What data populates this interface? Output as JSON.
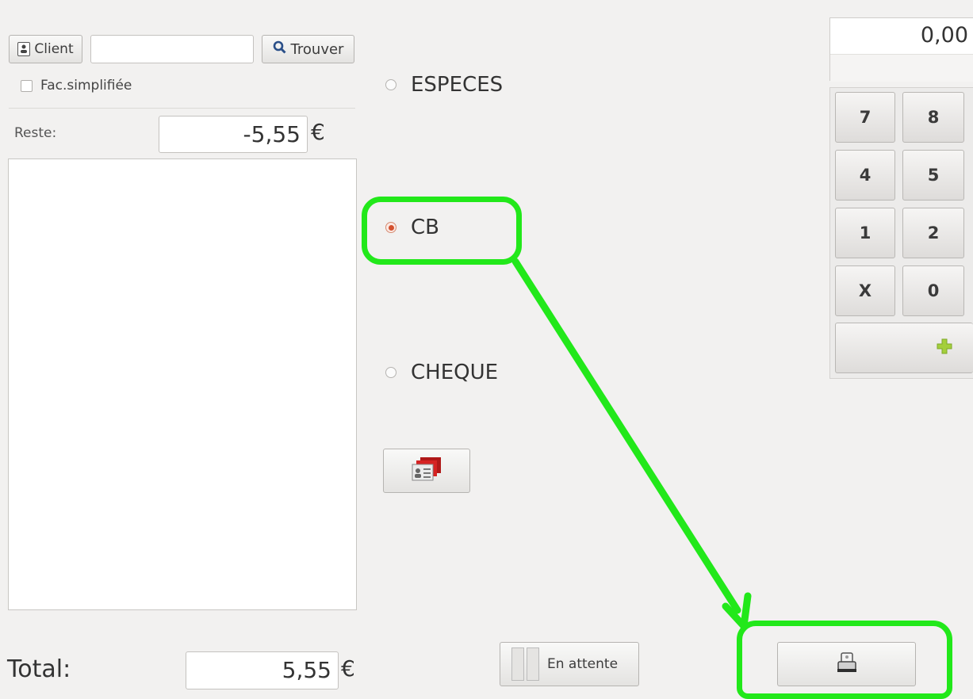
{
  "client": {
    "button_label": "Client",
    "field_value": "",
    "find_label": "Trouver",
    "simplified_invoice_label": "Fac.simplifiée"
  },
  "remaining": {
    "label": "Reste:",
    "value": "-5,55",
    "currency": "€"
  },
  "payment_methods": [
    {
      "label": "ESPECES",
      "selected": false
    },
    {
      "label": "CB",
      "selected": true
    },
    {
      "label": "CHEQUE",
      "selected": false
    }
  ],
  "amount_display": {
    "value": "0,00"
  },
  "keypad": {
    "keys": [
      "7",
      "8",
      "4",
      "5",
      "1",
      "2",
      "X",
      "0"
    ]
  },
  "total": {
    "label": "Total:",
    "value": "5,55",
    "currency": "€"
  },
  "hold_button_label": "En attente",
  "icons": {
    "client": "person-card-icon",
    "find": "magnifier-icon",
    "loyalty_card": "id-card-icon",
    "add": "plus-icon",
    "hold": "pause-icon",
    "print": "printer-icon"
  },
  "colors": {
    "highlight": "#22e81a",
    "radio_selected": "#d4512f",
    "plus_icon": "#9acd32"
  }
}
